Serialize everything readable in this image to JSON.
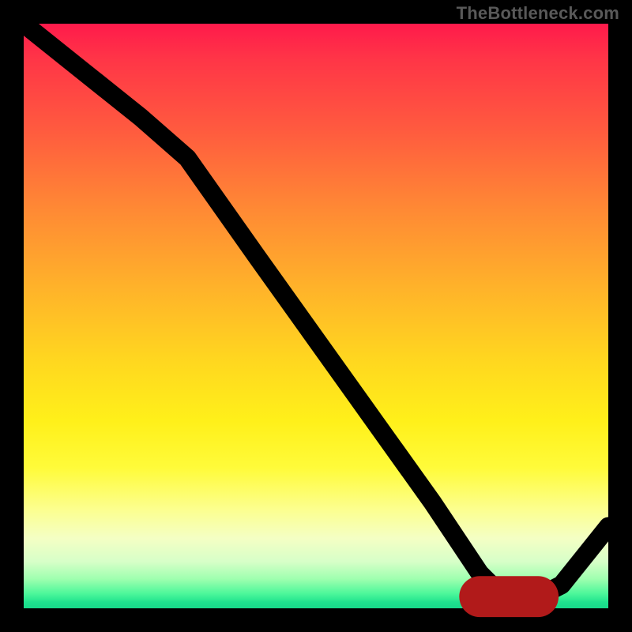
{
  "watermark": "TheBottleneck.com",
  "chart_data": {
    "type": "line",
    "title": "",
    "xlabel": "",
    "ylabel": "",
    "xlim": [
      0,
      100
    ],
    "ylim": [
      0,
      100
    ],
    "grid": false,
    "legend": false,
    "background_gradient": {
      "direction": "vertical",
      "stops": [
        {
          "pos": 0.0,
          "color": "#ff1a4b"
        },
        {
          "pos": 0.18,
          "color": "#ff5a3f"
        },
        {
          "pos": 0.45,
          "color": "#ffd81f"
        },
        {
          "pos": 0.76,
          "color": "#fffb3a"
        },
        {
          "pos": 0.92,
          "color": "#d7ffc8"
        },
        {
          "pos": 1.0,
          "color": "#18d98a"
        }
      ]
    },
    "series": [
      {
        "name": "curve",
        "type": "line",
        "color": "#000000",
        "x": [
          0,
          10,
          20,
          28,
          40,
          50,
          60,
          70,
          78,
          82,
          88,
          92,
          100
        ],
        "y": [
          100,
          92,
          84,
          77,
          60,
          46,
          32,
          18,
          6,
          2,
          2,
          4,
          14
        ]
      }
    ],
    "annotations": [
      {
        "name": "flat-minimum-marker",
        "type": "segment",
        "color": "#b11a1a",
        "x0": 78,
        "y0": 2,
        "x1": 88,
        "y1": 2
      }
    ]
  }
}
